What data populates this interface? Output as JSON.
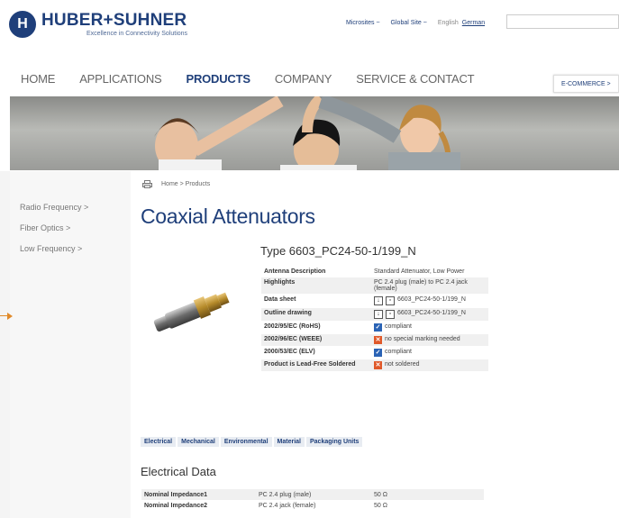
{
  "brand": {
    "logo_letter": "H",
    "name": "HUBER+SUHNER",
    "tagline": "Excellence in Connectivity Solutions",
    "color": "#1f3f7a"
  },
  "toplinks": {
    "microsites": "Microsites ~",
    "global_site": "Global Site ~",
    "lang_english": "English",
    "lang_german": "German"
  },
  "mainnav": {
    "items": [
      "HOME",
      "APPLICATIONS",
      "PRODUCTS",
      "COMPANY",
      "SERVICE & CONTACT"
    ],
    "active": "PRODUCTS",
    "ecommerce": "E-COMMERCE  >"
  },
  "leftnav": {
    "items": [
      "Radio Frequency >",
      "Fiber Optics >",
      "Low Frequency >"
    ]
  },
  "breadcrumb": "Home > Products",
  "page_title": "Coaxial Attenuators",
  "product": {
    "type_title": "Type 6603_PC24-50-1/199_N",
    "specs": [
      {
        "label": "Antenna Description",
        "value": "Standard Attenuator, Low Power",
        "icon": ""
      },
      {
        "label": "Highlights",
        "value": "PC 2.4 plug (male) to PC 2.4 jack (female)",
        "icon": ""
      },
      {
        "label": "Data sheet",
        "value": "6603_PC24-50-1/199_N",
        "icon": "download-icon"
      },
      {
        "label": "Outline drawing",
        "value": "6603_PC24-50-1/199_N",
        "icon": "download-icon"
      },
      {
        "label": "2002/95/EC (RoHS)",
        "value": "compliant",
        "icon": "check-icon"
      },
      {
        "label": "2002/96/EC (WEEE)",
        "value": "no special marking needed",
        "icon": "cross-icon"
      },
      {
        "label": "2000/53/EC (ELV)",
        "value": "compliant",
        "icon": "check-icon"
      },
      {
        "label": "Product is Lead-Free Soldered",
        "value": "not soldered",
        "icon": "cross-icon"
      }
    ]
  },
  "tabs": [
    "Electrical",
    "Mechanical",
    "Environmental",
    "Material",
    "Packaging Units"
  ],
  "electrical": {
    "title": "Electrical Data",
    "rows": [
      {
        "name": "Nominal Impedance1",
        "desc": "PC 2.4 plug (male)",
        "value": "50 Ω"
      },
      {
        "name": "Nominal Impedance2",
        "desc": "PC 2.4 jack (female)",
        "value": "50 Ω"
      }
    ]
  },
  "colors": {
    "accent": "#1f3f7a",
    "check": "#2a63b5",
    "cross": "#e0592a",
    "arrow": "#e08a2a"
  }
}
